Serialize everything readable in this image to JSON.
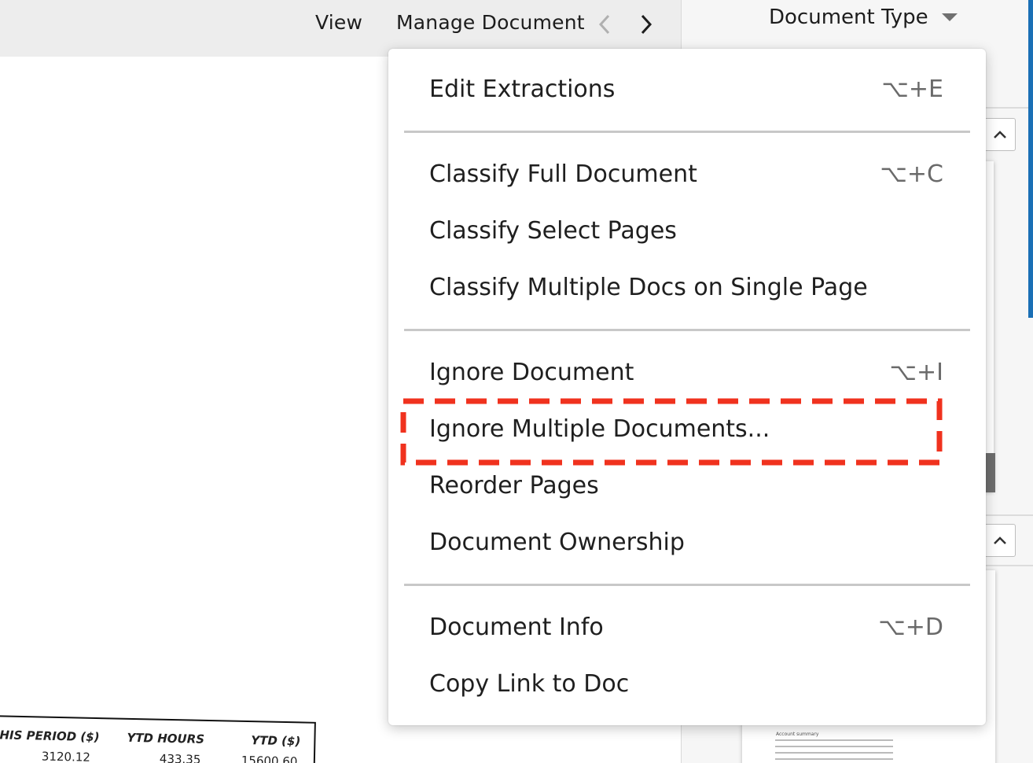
{
  "toolbar": {
    "view_label": "View",
    "manage_label": "Manage Document"
  },
  "right_panel": {
    "document_type_label": "Document Type"
  },
  "menu": {
    "items": [
      {
        "label": "Edit Extractions",
        "shortcut": "⌥+E"
      },
      {
        "label": "Classify Full Document",
        "shortcut": "⌥+C"
      },
      {
        "label": "Classify Select Pages",
        "shortcut": ""
      },
      {
        "label": "Classify Multiple Docs on Single Page",
        "shortcut": ""
      },
      {
        "label": "Ignore Document",
        "shortcut": "⌥+I"
      },
      {
        "label": "Ignore Multiple Documents...",
        "shortcut": ""
      },
      {
        "label": "Reorder Pages",
        "shortcut": ""
      },
      {
        "label": "Document Ownership",
        "shortcut": ""
      },
      {
        "label": "Document Info",
        "shortcut": "⌥+D"
      },
      {
        "label": "Copy Link to Doc",
        "shortcut": ""
      }
    ],
    "highlighted_item": "Ignore Multiple Documents..."
  },
  "paystub": {
    "headers": [
      "HIS PERIOD ($)",
      "YTD HOURS",
      "YTD ($)"
    ],
    "values": [
      "3120.12",
      "433.35",
      "15600.60"
    ]
  },
  "thumbnail": {
    "title": "Account summary"
  },
  "colors": {
    "highlight": "#f0321e",
    "accent": "#1a6fb5"
  }
}
